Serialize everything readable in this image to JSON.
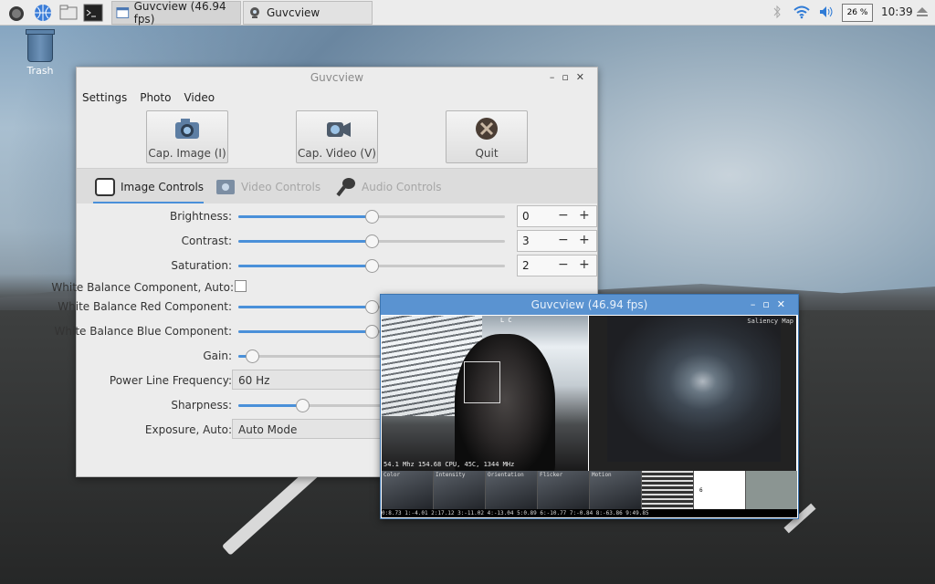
{
  "taskbar": {
    "window_buttons": [
      {
        "label": "Guvcview  (46.94 fps)"
      },
      {
        "label": "Guvcview"
      }
    ],
    "cpu_label": "26 %",
    "clock": "10:39"
  },
  "desktop": {
    "trash_label": "Trash"
  },
  "main_window": {
    "title": "Guvcview",
    "menu": [
      "Settings",
      "Photo",
      "Video"
    ],
    "buttons": {
      "cap_image": "Cap. Image (I)",
      "cap_video": "Cap. Video (V)",
      "quit": "Quit"
    },
    "tabs": [
      "Image Controls",
      "Video Controls",
      "Audio Controls"
    ],
    "controls": {
      "brightness": {
        "label": "Brightness:",
        "value": "0",
        "level": 0.5
      },
      "contrast": {
        "label": "Contrast:",
        "value": "3",
        "level": 0.5
      },
      "saturation": {
        "label": "Saturation:",
        "value": "2",
        "level": 0.5
      },
      "wb_auto": {
        "label": "White Balance Component, Auto:"
      },
      "wb_red": {
        "label": "White Balance Red Component:",
        "level": 0.5
      },
      "wb_blue": {
        "label": "White Balance Blue Component:",
        "level": 0.5
      },
      "gain": {
        "label": "Gain:",
        "level": 0.05
      },
      "power_line": {
        "label": "Power Line Frequency:",
        "value": "60 Hz"
      },
      "sharpness": {
        "label": "Sharpness:",
        "level": 0.24
      },
      "exposure_auto": {
        "label": "Exposure, Auto:",
        "value": "Auto Mode"
      }
    },
    "spin_minus": "−",
    "spin_plus": "+"
  },
  "video_window": {
    "title": "Guvcview  (46.94 fps)",
    "overlay_top": "L  C",
    "stats": "54.1  Mhz 154.68 CPU, 45C, 1344 MHz",
    "saliency_label": "Saliency Map",
    "thumb_labels": [
      "Color",
      "Intensity",
      "Orientation",
      "Flicker",
      "Motion",
      "",
      "6",
      ""
    ],
    "status_line": "0:8.73 1:-4.01 2:17.12 3:-11.02 4:-13.04 5:0.89 6:-10.77 7:-0.84 8:-63.86 9:49.85"
  }
}
